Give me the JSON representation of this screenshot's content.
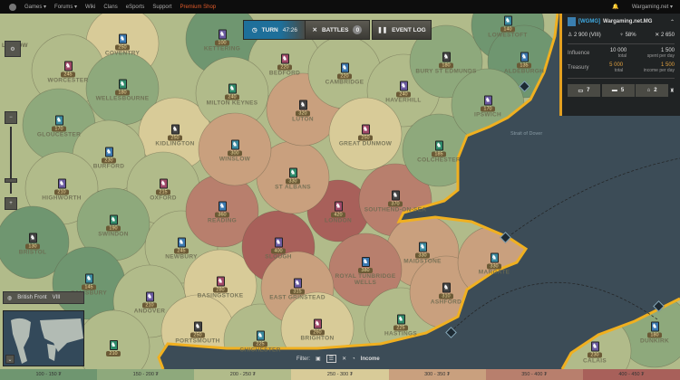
{
  "topnav": {
    "items": [
      "Games ▾",
      "Forums ▾",
      "Wiki",
      "Clans",
      "eSports",
      "Support"
    ],
    "premium": "Premium Shop",
    "account": "Wargaming.net ▾"
  },
  "toolbar": {
    "turn_label": "TURN",
    "turn_time": "47:26",
    "battles_label": "BATTLES",
    "battles_count": "0",
    "event_log_label": "EVENT LOG"
  },
  "clan_panel": {
    "tag": "[WGMG]",
    "name": "Wargaming.net.MG",
    "rating": "2 900 (VIII)",
    "winrate": "58%",
    "battles": "2 650",
    "influence_label": "Influence",
    "influence_total": "10 000",
    "influence_total_sub": "total",
    "influence_spent": "1 500",
    "influence_spent_sub": "spent per day",
    "treasury_label": "Treasury",
    "treasury_total": "5 000",
    "treasury_total_sub": "total",
    "treasury_income": "1 500",
    "treasury_income_sub": "income per day",
    "buttons": [
      "7",
      "5",
      "2"
    ]
  },
  "front": {
    "label": "British Front",
    "tier": "VIII"
  },
  "filter": {
    "label": "Filter:",
    "income_label": "Income"
  },
  "map_labels": {
    "sea": "Strait of Dover",
    "ludlow": "LUDLOW"
  },
  "provinces": [
    {
      "name": "Coventry",
      "value": "250"
    },
    {
      "name": "Kettering",
      "value": "100"
    },
    {
      "name": "Worcester",
      "value": "245"
    },
    {
      "name": "Wellesbourne",
      "value": "180"
    },
    {
      "name": "Kidlington",
      "value": "250"
    },
    {
      "name": "Gloucester",
      "value": "170"
    },
    {
      "name": "Burford",
      "value": "230"
    },
    {
      "name": "Highworth",
      "value": "210"
    },
    {
      "name": "Oxford",
      "value": "215"
    },
    {
      "name": "Swindon",
      "value": "190"
    },
    {
      "name": "Bristol",
      "value": "130"
    },
    {
      "name": "Salisbury",
      "value": "145"
    },
    {
      "name": "Newbury",
      "value": "245"
    },
    {
      "name": "Andover",
      "value": "210"
    },
    {
      "name": "Basingstoke",
      "value": "280"
    },
    {
      "name": "",
      "value": "210"
    },
    {
      "name": "Portsmouth",
      "value": "250"
    },
    {
      "name": "Chichester",
      "value": "225"
    },
    {
      "name": "Reading",
      "value": "360"
    },
    {
      "name": "Slough",
      "value": "400"
    },
    {
      "name": "London",
      "value": "420"
    },
    {
      "name": "St Albans",
      "value": "330"
    },
    {
      "name": "Southend-on-Sea",
      "value": "370"
    },
    {
      "name": "Maidstone",
      "value": "330"
    },
    {
      "name": "Royal Tunbridge Wells",
      "value": "380"
    },
    {
      "name": "East Grinstead",
      "value": "315"
    },
    {
      "name": "Brighton",
      "value": "260"
    },
    {
      "name": "Hastings",
      "value": "225"
    },
    {
      "name": "Ashford",
      "value": "310"
    },
    {
      "name": "Margate",
      "value": "330"
    },
    {
      "name": "Dunkirk",
      "value": "180"
    },
    {
      "name": "Calais",
      "value": "230"
    },
    {
      "name": "Bedford",
      "value": "220"
    },
    {
      "name": "Milton Keynes",
      "value": "240"
    },
    {
      "name": "Luton",
      "value": "320"
    },
    {
      "name": "Winslow",
      "value": "300"
    },
    {
      "name": "Cambridge",
      "value": "220"
    },
    {
      "name": "Haverhill",
      "value": "240"
    },
    {
      "name": "Great Dunmow",
      "value": "250"
    },
    {
      "name": "Colchester",
      "value": "185"
    },
    {
      "name": "Bury St Edmunds",
      "value": "180"
    },
    {
      "name": "Lowestoft",
      "value": "140"
    },
    {
      "name": "Aldeburgh",
      "value": "135"
    },
    {
      "name": "Ipswich",
      "value": "170"
    }
  ],
  "legend": [
    {
      "label": "100 - 150 ₮",
      "color": "#6f9670"
    },
    {
      "label": "150 - 200 ₮",
      "color": "#8ea97c"
    },
    {
      "label": "200 - 250 ₮",
      "color": "#b1bb8a"
    },
    {
      "label": "250 - 300 ₮",
      "color": "#d8cb98"
    },
    {
      "label": "300 - 350 ₮",
      "color": "#c9a07e"
    },
    {
      "label": "350 - 400 ₮",
      "color": "#b87f6d"
    },
    {
      "label": "400 - 450 ₮",
      "color": "#a8605a"
    }
  ],
  "colors": {
    "accent": "#e4a020",
    "sea": "#3c4c57",
    "turn": "#1e6f9a"
  }
}
